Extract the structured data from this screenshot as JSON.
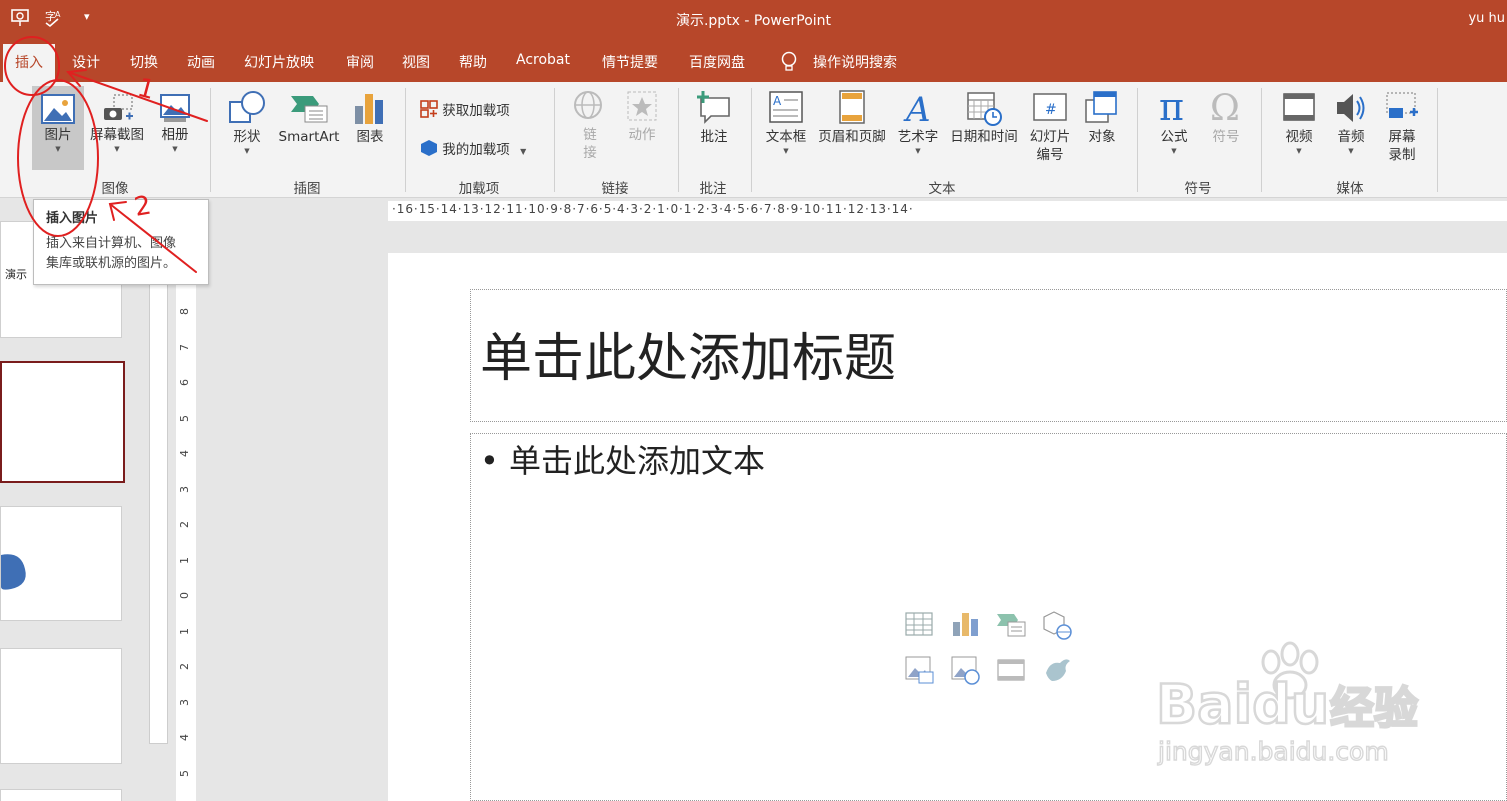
{
  "window": {
    "title": "演示.pptx - PowerPoint",
    "user": "yu hu"
  },
  "tabs": [
    {
      "label": "插入",
      "active": true
    },
    {
      "label": "设计"
    },
    {
      "label": "切换"
    },
    {
      "label": "动画"
    },
    {
      "label": "幻灯片放映"
    },
    {
      "label": "审阅"
    },
    {
      "label": "视图"
    },
    {
      "label": "帮助"
    },
    {
      "label": "Acrobat"
    },
    {
      "label": "情节提要"
    },
    {
      "label": "百度网盘"
    },
    {
      "label": "操作说明搜索",
      "icon": "lightbulb-icon"
    }
  ],
  "ribbon": {
    "images": {
      "group": "图像",
      "picture": "图片",
      "screenshot": "屏幕截图",
      "album": "相册"
    },
    "illustrations": {
      "group": "插图",
      "shapes": "形状",
      "smartart": "SmartArt",
      "chart": "图表"
    },
    "addins": {
      "group": "加载项",
      "get": "获取加载项",
      "mine": "我的加载项"
    },
    "links": {
      "group": "链接",
      "link": "链接",
      "action": "动作"
    },
    "comments": {
      "group": "批注",
      "comment": "批注"
    },
    "text": {
      "group": "文本",
      "textbox": "文本框",
      "header_footer": "页眉和页脚",
      "wordart": "艺术字",
      "datetime": "日期和时间",
      "slide_number_1": "幻灯片",
      "slide_number_2": "编号",
      "object": "对象"
    },
    "symbols": {
      "group": "符号",
      "equation": "公式",
      "symbol": "符号"
    },
    "media": {
      "group": "媒体",
      "video": "视频",
      "audio": "音频",
      "screen_rec_1": "屏幕",
      "screen_rec_2": "录制"
    }
  },
  "tooltip": {
    "title": "插入图片",
    "desc_1": "插入来自计算机、图像",
    "desc_2": "集库或联机源的图片。"
  },
  "thumbs": {
    "label": "演示"
  },
  "ruler": {
    "h": "·16·15·14·13·12·11·10·9·8·7·6·5·4·3·2·1·0·1·2·3·4·5·6·7·8·9·10·11·12·13·14·",
    "v": [
      "8",
      "7",
      "6",
      "5",
      "4",
      "3",
      "2",
      "1",
      "0",
      "1",
      "2",
      "3",
      "4",
      "5"
    ]
  },
  "slide": {
    "title_placeholder": "单击此处添加标题",
    "body_placeholder": "• 单击此处添加文本"
  },
  "annotations": {
    "num1": "1",
    "num2": "2"
  },
  "watermark": {
    "brand": "Baidu",
    "brand_cn": "经验",
    "url": "jingyan.baidu.com"
  },
  "colors": {
    "accent": "#b7472a",
    "ribbon": "#f3f3f3",
    "annotation": "#e02020"
  }
}
